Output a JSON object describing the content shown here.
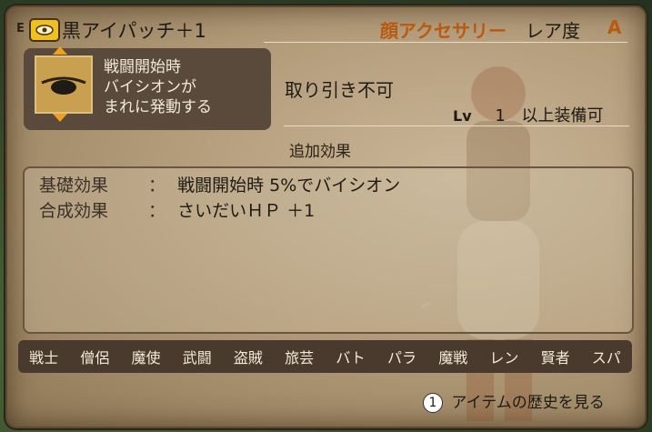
{
  "item": {
    "badge": "E",
    "name": "黒アイパッチ＋1",
    "category": "顔アクセサリー",
    "rarity_label": "レア度",
    "rarity_value": "A",
    "description": [
      "戦闘開始時",
      "バイシオンが",
      "まれに発動する"
    ],
    "trade": "取り引き不可",
    "level_label": "Lv",
    "level_value": "1",
    "level_suffix": "以上装備可"
  },
  "effects": {
    "header": "追加効果",
    "rows": [
      {
        "label": "基礎効果",
        "sep": "：",
        "value": "戦闘開始時 5%でバイシオン"
      },
      {
        "label": "合成効果",
        "sep": "：",
        "value": "さいだいＨＰ ＋1"
      }
    ]
  },
  "jobs": [
    "戦士",
    "僧侶",
    "魔使",
    "武闘",
    "盗賊",
    "旅芸",
    "バト",
    "パラ",
    "魔戦",
    "レン",
    "賢者",
    "スパ"
  ],
  "footer": {
    "button_glyph": "1",
    "history_label": "アイテムの歴史を見る"
  },
  "colors": {
    "category": "#b85a10",
    "parchment": "#b39c7a",
    "dark_box": "#5a4a3c"
  }
}
